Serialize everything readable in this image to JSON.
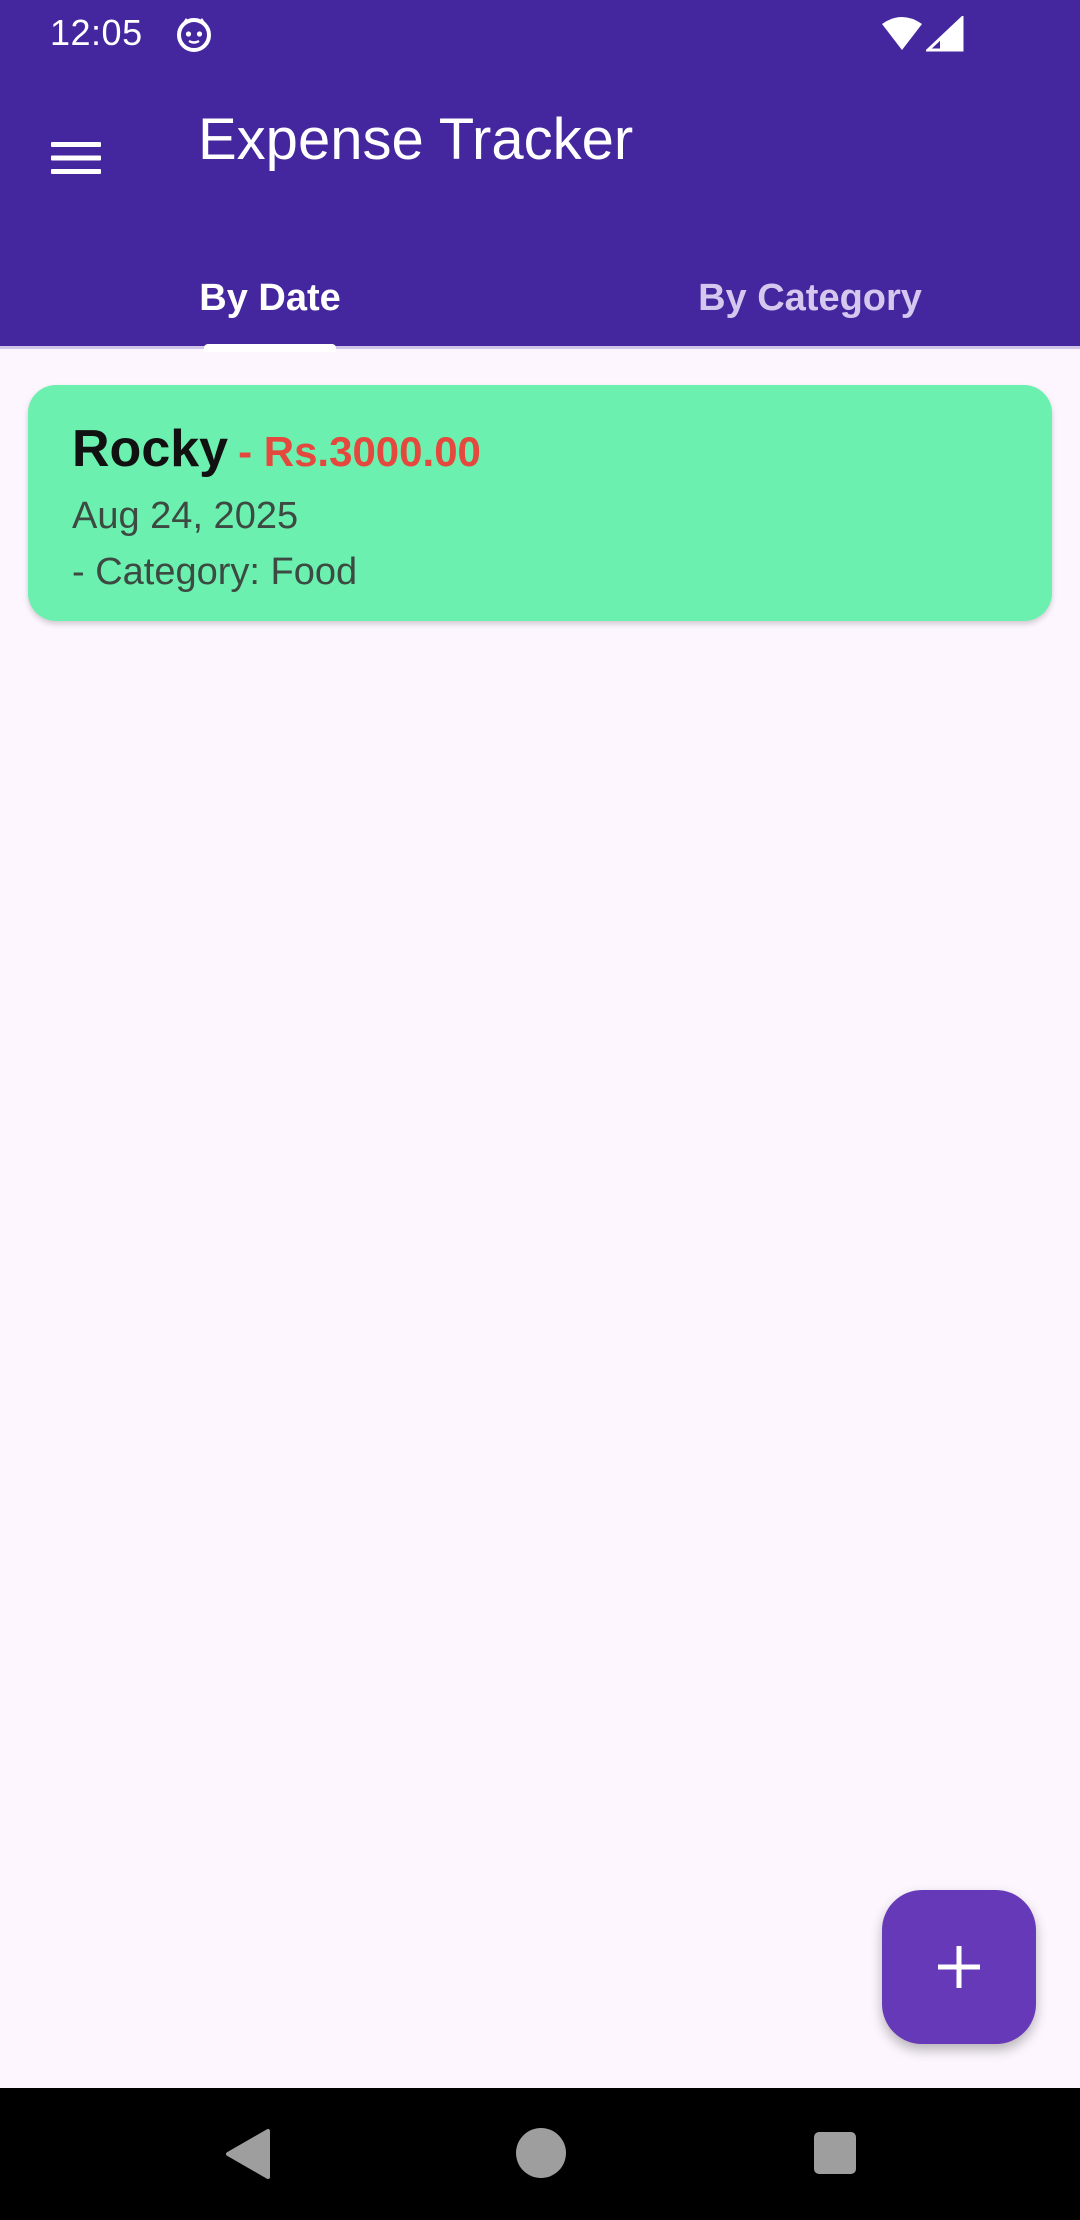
{
  "status_bar": {
    "time": "12:05",
    "app_icon": "cat-face-icon",
    "wifi_icon": "wifi-icon",
    "signal_icon": "cell-signal-icon"
  },
  "app_bar": {
    "title": "Expense Tracker",
    "menu_icon": "hamburger-menu-icon"
  },
  "tabs": [
    {
      "label": "By Date",
      "selected": true
    },
    {
      "label": "By Category",
      "selected": false
    }
  ],
  "expenses": [
    {
      "name": "Rocky",
      "amount": "- Rs.3000.00",
      "date": "Aug 24, 2025",
      "category": "- Category: Food"
    }
  ],
  "fab": {
    "icon": "plus-icon"
  },
  "nav_bar": {
    "back_icon": "back-triangle-icon",
    "home_icon": "home-circle-icon",
    "recents_icon": "recents-square-icon"
  },
  "colors": {
    "app_bar": "#44279E",
    "background": "#FDF6FE",
    "card": "#6BF0AF",
    "amount": "#E5483D",
    "fab": "#6639B8"
  }
}
